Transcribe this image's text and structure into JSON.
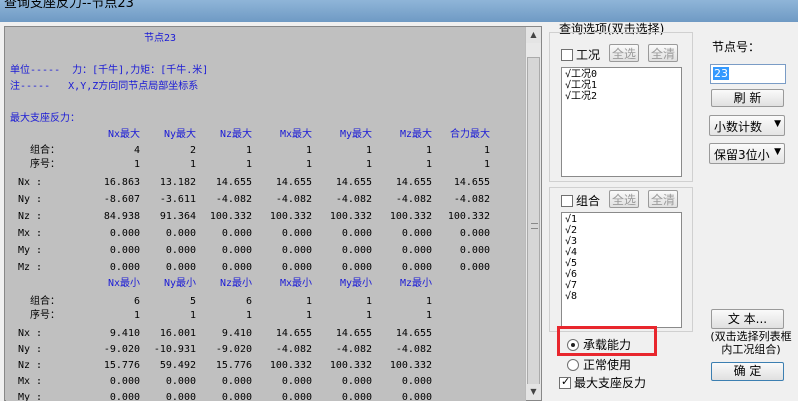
{
  "window": {
    "title": "查询支座反力--节点23"
  },
  "report": {
    "header": "节点23",
    "units": "单位-----  力：[千牛],力矩：[千牛.米]",
    "note": "注-----   X,Y,Z方向同节点局部坐标系",
    "section_title": "最大支座反力：",
    "max_columns": [
      "Nx最大",
      "Ny最大",
      "Nz最大",
      "Mx最大",
      "My最大",
      "Mz最大",
      "合力最大"
    ],
    "max_combo_label": "组合：",
    "max_combo_values": [
      "4",
      "2",
      "1",
      "1",
      "1",
      "1",
      "1"
    ],
    "max_seq_label": "序号：",
    "max_seq_values": [
      "1",
      "1",
      "1",
      "1",
      "1",
      "1",
      "1"
    ],
    "max_rows": [
      {
        "name": "Nx  :",
        "values": [
          "16.863",
          "13.182",
          "14.655",
          "14.655",
          "14.655",
          "14.655",
          "14.655"
        ]
      },
      {
        "name": "Ny  :",
        "values": [
          "-8.607",
          "-3.611",
          "-4.082",
          "-4.082",
          "-4.082",
          "-4.082",
          "-4.082"
        ]
      },
      {
        "name": "Nz  :",
        "values": [
          "84.938",
          "91.364",
          "100.332",
          "100.332",
          "100.332",
          "100.332",
          "100.332"
        ]
      },
      {
        "name": "Mx  :",
        "values": [
          "0.000",
          "0.000",
          "0.000",
          "0.000",
          "0.000",
          "0.000",
          "0.000"
        ]
      },
      {
        "name": "My  :",
        "values": [
          "0.000",
          "0.000",
          "0.000",
          "0.000",
          "0.000",
          "0.000",
          "0.000"
        ]
      },
      {
        "name": "Mz  :",
        "values": [
          "0.000",
          "0.000",
          "0.000",
          "0.000",
          "0.000",
          "0.000",
          "0.000"
        ]
      }
    ],
    "min_columns": [
      "Nx最小",
      "Ny最小",
      "Nz最小",
      "Mx最小",
      "My最小",
      "Mz最小"
    ],
    "min_combo_label": "组合：",
    "min_combo_values": [
      "6",
      "5",
      "6",
      "1",
      "1",
      "1"
    ],
    "min_seq_label": "序号：",
    "min_seq_values": [
      "1",
      "1",
      "1",
      "1",
      "1",
      "1"
    ],
    "min_rows": [
      {
        "name": "Nx  :",
        "values": [
          "9.410",
          "16.001",
          "9.410",
          "14.655",
          "14.655",
          "14.655"
        ]
      },
      {
        "name": "Ny  :",
        "values": [
          "-9.020",
          "-10.931",
          "-9.020",
          "-4.082",
          "-4.082",
          "-4.082"
        ]
      },
      {
        "name": "Nz  :",
        "values": [
          "15.776",
          "59.492",
          "15.776",
          "100.332",
          "100.332",
          "100.332"
        ]
      },
      {
        "name": "Mx  :",
        "values": [
          "0.000",
          "0.000",
          "0.000",
          "0.000",
          "0.000",
          "0.000"
        ]
      },
      {
        "name": "My  :",
        "values": [
          "0.000",
          "0.000",
          "0.000",
          "0.000",
          "0.000",
          "0.000"
        ]
      }
    ]
  },
  "options": {
    "title": "查询选项(双击选择)",
    "case_label": "工况",
    "case_select_all": "全选",
    "case_clear_all": "全清",
    "case_items": [
      "√工况0",
      "√工况1",
      "√工况2"
    ],
    "combo_label": "组合",
    "combo_select_all": "全选",
    "combo_clear_all": "全清",
    "combo_items": [
      "√1",
      "√2",
      "√3",
      "√4",
      "√5",
      "√6",
      "√7",
      "√8"
    ],
    "radio_capacity": "承载能力",
    "radio_normal": "正常使用",
    "max_reaction_label": "最大支座反力"
  },
  "right": {
    "node_label": "节点号：",
    "node_value": "23",
    "refresh_label": "刷  新",
    "decimal_mode": "小数计数",
    "precision": "保留3位小",
    "text_button": "文  本...",
    "note": "(双击选择列表框内工况组合)",
    "ok_button": "确  定"
  },
  "colors": {
    "report_bg": "#c0c0c0",
    "report_blue": "#1a1ad6",
    "highlight_red": "#e8262d",
    "selection_blue": "#3399ff"
  }
}
